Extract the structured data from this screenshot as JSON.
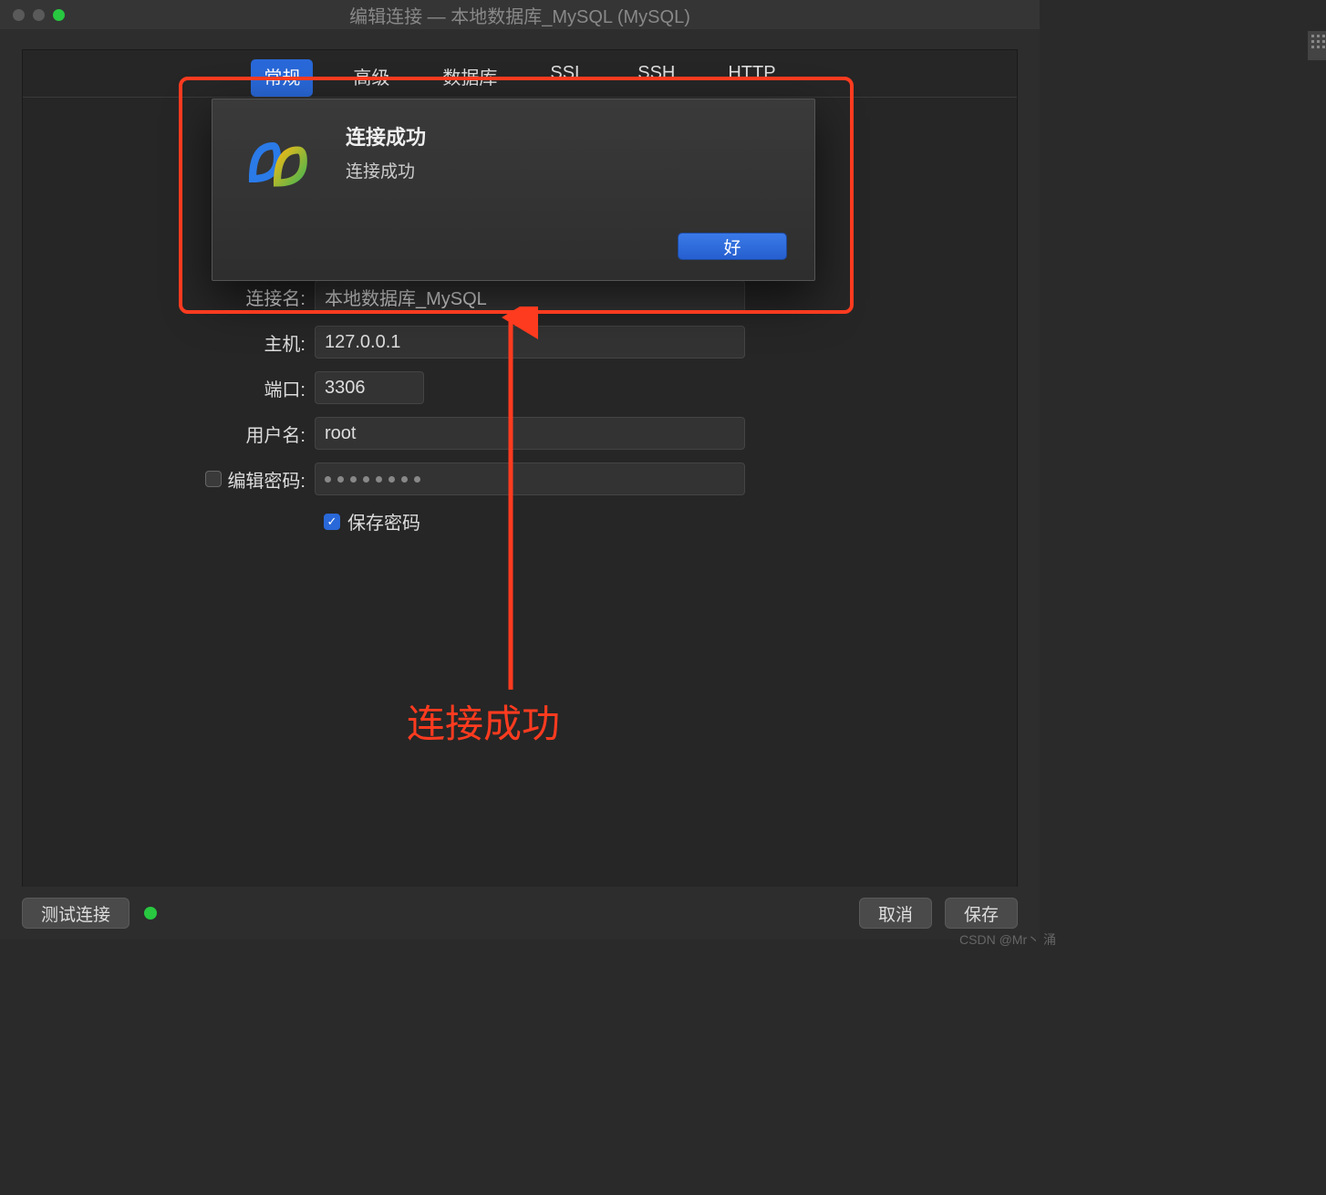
{
  "window": {
    "title": "编辑连接 — 本地数据库_MySQL (MySQL)"
  },
  "tabs": {
    "items": [
      "常规",
      "高级",
      "数据库",
      "SSL",
      "SSH",
      "HTTP"
    ],
    "active_index": 0
  },
  "form": {
    "conn_name_label": "连接名:",
    "conn_name_value": "本地数据库_MySQL",
    "host_label": "主机:",
    "host_value": "127.0.0.1",
    "port_label": "端口:",
    "port_value": "3306",
    "user_label": "用户名:",
    "user_value": "root",
    "edit_pw_label": "编辑密码:",
    "password_dot_count": 8,
    "save_pw_label": "保存密码"
  },
  "dialog": {
    "title": "连接成功",
    "message": "连接成功",
    "ok": "好"
  },
  "annotation": {
    "label": "连接成功"
  },
  "footer": {
    "test": "测试连接",
    "cancel": "取消",
    "save": "保存"
  },
  "watermark": "CSDN @Mr丶 涌"
}
